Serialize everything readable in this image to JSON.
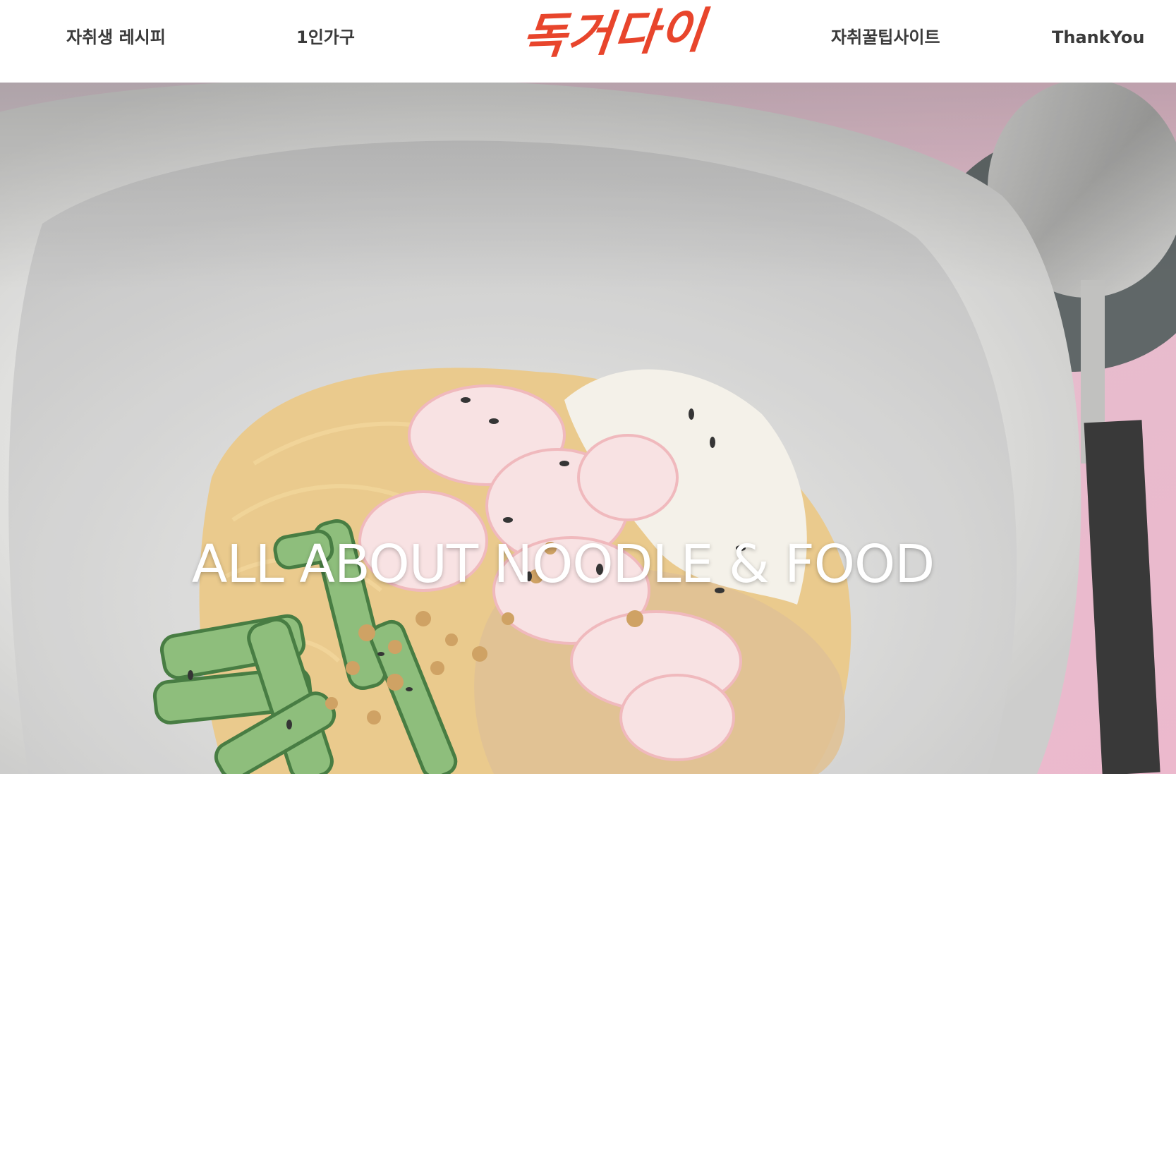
{
  "header": {
    "logo": {
      "text": "독거다이",
      "color": "#e8452c"
    },
    "nav": [
      {
        "label": "자취생 레시피"
      },
      {
        "label": "1인가구"
      },
      {
        "label": "자취꿀팁사이트"
      },
      {
        "label": "ThankYou"
      }
    ]
  },
  "hero": {
    "title": "ALL ABOUT NOODLE & FOOD",
    "image": "noodle-dish-photo"
  },
  "colors": {
    "accent": "#e8452c",
    "nav_text": "#3a3a3a",
    "background": "#ffffff"
  }
}
